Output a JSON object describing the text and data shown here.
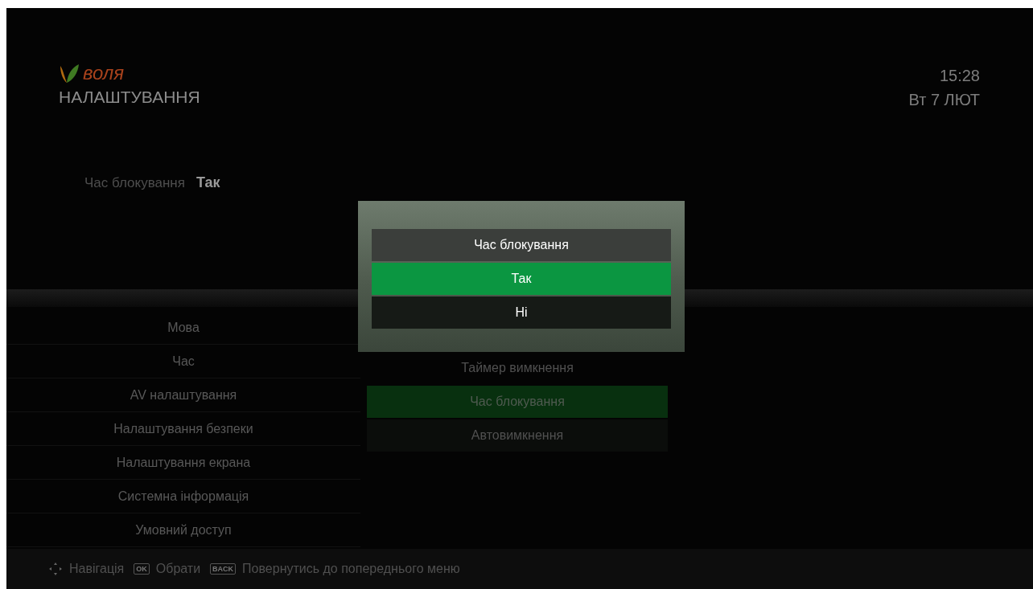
{
  "header": {
    "logo": "воля",
    "title": "НАЛАШТУВАННЯ",
    "time": "15:28",
    "date": "Вт 7 ЛЮТ"
  },
  "preview": {
    "label": "Час блокування",
    "value": "Так"
  },
  "menu": {
    "items": [
      {
        "label": "Мова"
      },
      {
        "label": "Час"
      },
      {
        "label": "AV налаштування"
      },
      {
        "label": "Налаштування безпеки"
      },
      {
        "label": "Налаштування екрана"
      },
      {
        "label": "Системна інформація"
      },
      {
        "label": "Умовний доступ"
      }
    ]
  },
  "submenu": {
    "items": [
      {
        "label": "Таймер вимкнення",
        "selected": false,
        "kind": "plain"
      },
      {
        "label": "Час блокування",
        "selected": true,
        "kind": "box"
      },
      {
        "label": "Автовимкнення",
        "selected": false,
        "kind": "box"
      }
    ]
  },
  "dialog": {
    "title": "Час блокування",
    "options": [
      {
        "label": "Так",
        "selected": true
      },
      {
        "label": "Ні",
        "selected": false
      }
    ]
  },
  "footer": {
    "hints": [
      {
        "kind": "dpad",
        "label": "Навігація"
      },
      {
        "kind": "key",
        "key": "OK",
        "label": "Обрати"
      },
      {
        "kind": "key",
        "key": "BACK",
        "label": "Повернутись до попереднього меню"
      }
    ]
  }
}
